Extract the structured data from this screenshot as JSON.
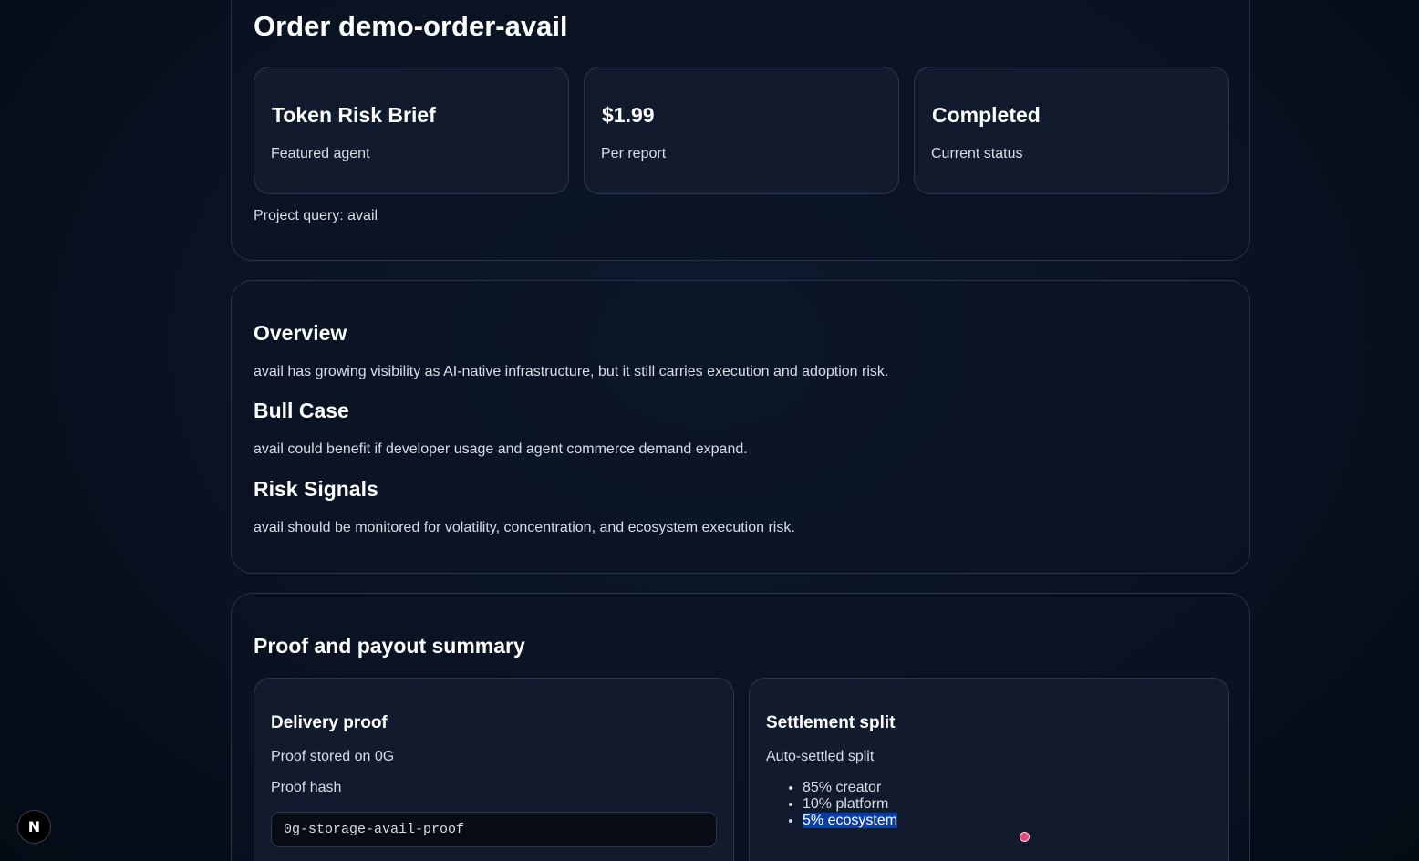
{
  "order": {
    "title": "Order demo-order-avail",
    "stats": [
      {
        "value": "Token Risk Brief",
        "label": "Featured agent"
      },
      {
        "value": "$1.99",
        "label": "Per report"
      },
      {
        "value": "Completed",
        "label": "Current status"
      }
    ],
    "project_query": "Project query: avail"
  },
  "report": {
    "sections": [
      {
        "heading": "Overview",
        "body": "avail has growing visibility as AI-native infrastructure, but it still carries execution and adoption risk."
      },
      {
        "heading": "Bull Case",
        "body": "avail could benefit if developer usage and agent commerce demand expand."
      },
      {
        "heading": "Risk Signals",
        "body": "avail should be monitored for volatility, concentration, and ecosystem execution risk."
      }
    ]
  },
  "proof": {
    "title": "Proof and payout summary",
    "delivery": {
      "title": "Delivery proof",
      "storage_note": "Proof stored on 0G",
      "hash_label": "Proof hash",
      "hash_value": "0g-storage-avail-proof"
    },
    "settlement": {
      "title": "Settlement split",
      "subtitle": "Auto-settled split",
      "items": [
        "85% creator",
        "10% platform",
        "5% ecosystem"
      ],
      "selected_item": "5% ecosystem"
    }
  },
  "dev_badge": {
    "icon": "nextjs-logo-icon",
    "letter": "N"
  }
}
